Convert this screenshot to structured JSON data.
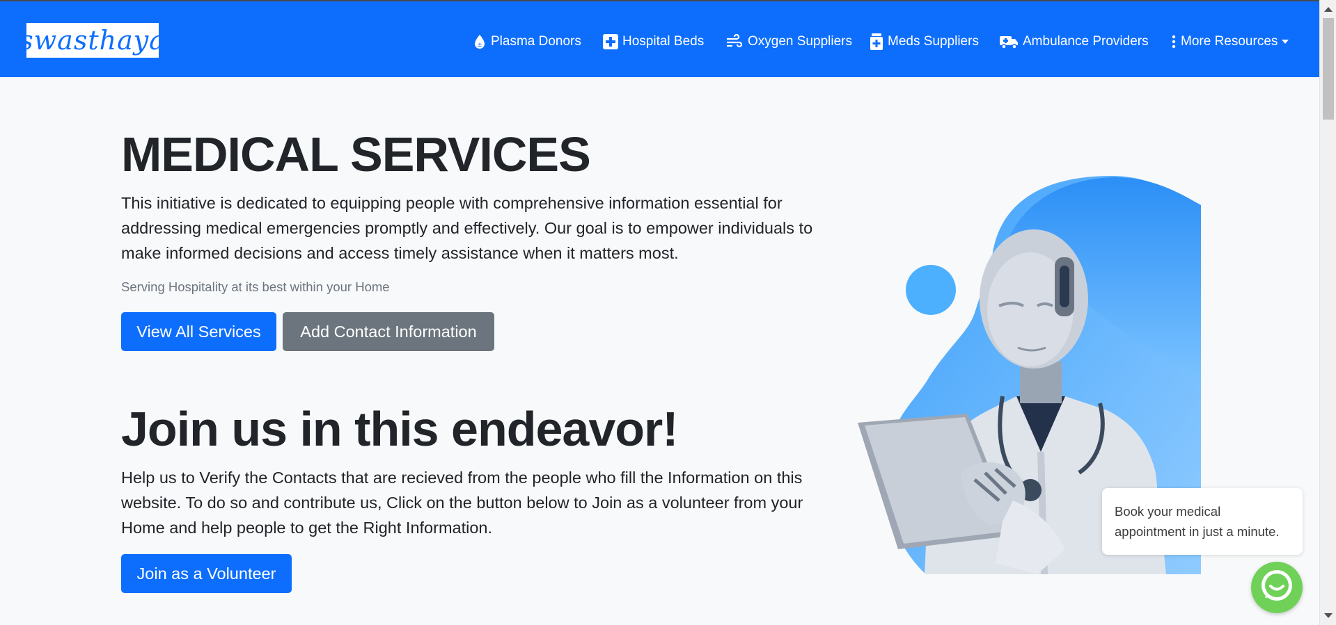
{
  "brand": {
    "logo_text": "swasthaya"
  },
  "nav": {
    "plasma": "Plasma Donors",
    "beds": "Hospital Beds",
    "oxygen": "Oxygen Suppliers",
    "meds": "Meds Suppliers",
    "ambulance": "Ambulance Providers",
    "more": "More Resources"
  },
  "hero": {
    "title": "MEDICAL SERVICES",
    "description": "This initiative is dedicated to equipping people with comprehensive information essential for addressing medical emergencies promptly and effectively. Our goal is to empower individuals to make informed decisions and access timely assistance when it matters most.",
    "tagline": "Serving Hospitality at its best within your Home",
    "view_all": "View All Services",
    "add_contact": "Add Contact Information"
  },
  "join": {
    "title": "Join us in this endeavor!",
    "description": "Help us to Verify the Contacts that are recieved from the people who fill the Information on this website. To do so and contribute us, Click on the button below to Join as a volunteer from your Home and help people to get the Right Information.",
    "button": "Join as a Volunteer"
  },
  "chat": {
    "bubble_text": "Book your medical appointment in just a minute."
  },
  "colors": {
    "primary": "#0d6efd",
    "secondary": "#6c757d",
    "background": "#f8f9fa",
    "chat": "#6fd158"
  }
}
